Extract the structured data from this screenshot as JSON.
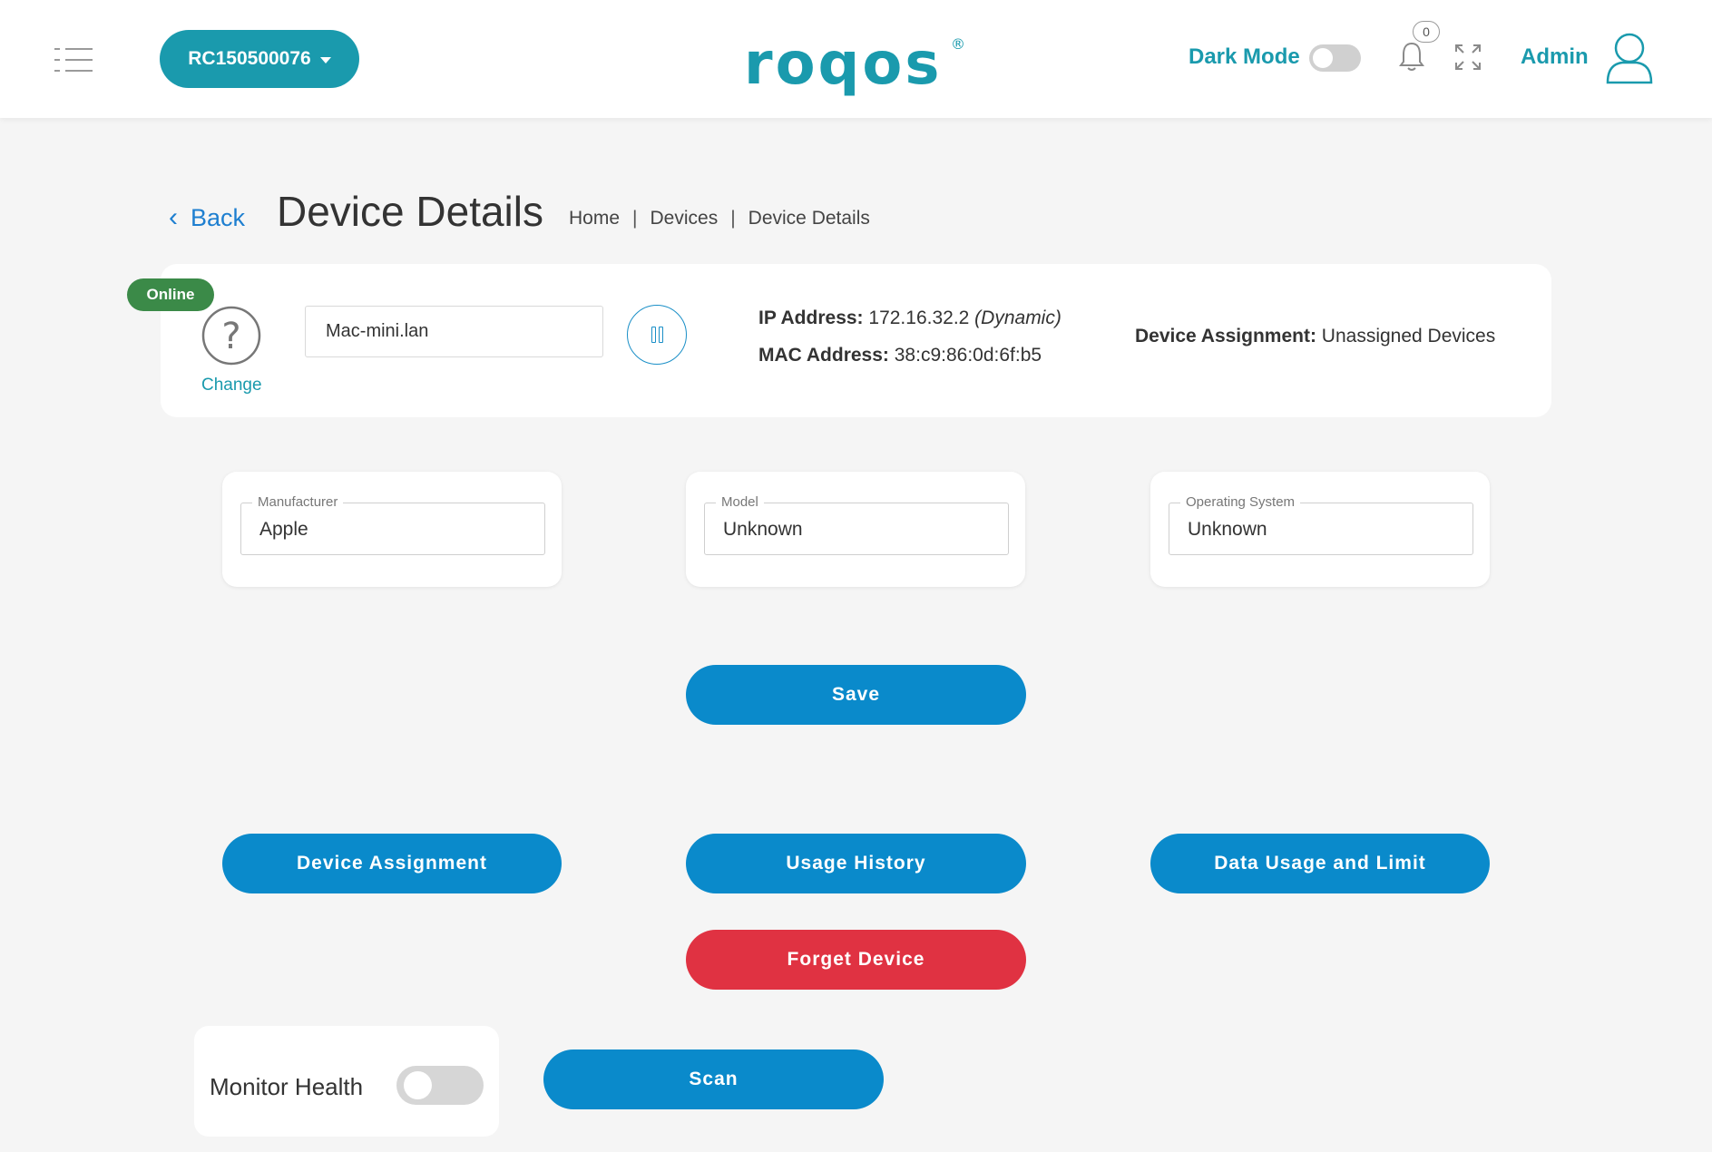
{
  "header": {
    "router_id": "RC150500076",
    "dark_mode_label": "Dark Mode",
    "notification_count": "0",
    "admin_label": "Admin",
    "brand_color": "#1a9aad"
  },
  "title_row": {
    "back_label": "Back",
    "page_title": "Device Details",
    "breadcrumb": [
      "Home",
      "Devices",
      "Device Details"
    ]
  },
  "device": {
    "status": "Online",
    "change_label": "Change",
    "name": "Mac-mini.lan",
    "ip_label": "IP Address:",
    "ip_value": "172.16.32.2",
    "ip_type": "(Dynamic)",
    "mac_label": "MAC Address:",
    "mac_value": "38:c9:86:0d:6f:b5",
    "assignment_label": "Device Assignment:",
    "assignment_value": "Unassigned Devices"
  },
  "fields": [
    {
      "label": "Manufacturer",
      "value": "Apple"
    },
    {
      "label": "Model",
      "value": "Unknown"
    },
    {
      "label": "Operating System",
      "value": "Unknown"
    }
  ],
  "buttons": {
    "save": "Save",
    "device_assignment": "Device Assignment",
    "usage_history": "Usage History",
    "data_usage": "Data Usage and Limit",
    "forget": "Forget Device",
    "scan": "Scan"
  },
  "monitor": {
    "label": "Monitor Health"
  },
  "colors": {
    "primary_button": "#0a8acb",
    "danger_button": "#e03242",
    "online_badge": "#3b8a48"
  }
}
